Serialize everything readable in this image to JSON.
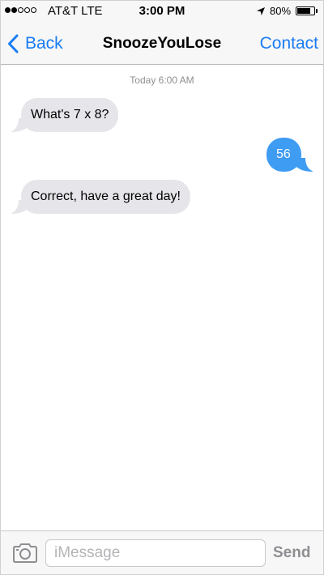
{
  "status_bar": {
    "signal_bars": 5,
    "signal_filled": 2,
    "carrier": "AT&T LTE",
    "time": "3:00 PM",
    "location_icon": "location-arrow-icon",
    "battery_percent_label": "80%",
    "battery_level": 0.8
  },
  "nav": {
    "back_label": "Back",
    "title": "SnoozeYouLose",
    "contact_label": "Contact"
  },
  "conversation": {
    "timestamp": "Today 6:00 AM",
    "messages": [
      {
        "direction": "incoming",
        "text": "What's 7 x 8?"
      },
      {
        "direction": "outgoing",
        "text": "56"
      },
      {
        "direction": "incoming",
        "text": "Correct, have a great day!"
      }
    ]
  },
  "composer": {
    "placeholder": "iMessage",
    "value": "",
    "send_label": "Send",
    "camera_icon": "camera-icon"
  },
  "colors": {
    "accent": "#1a7cf4",
    "incoming_bubble": "#e5e5ea",
    "outgoing_bubble": "#3f9cf3",
    "bar_background": "#f7f7f7",
    "muted_text": "#8e8e93"
  }
}
